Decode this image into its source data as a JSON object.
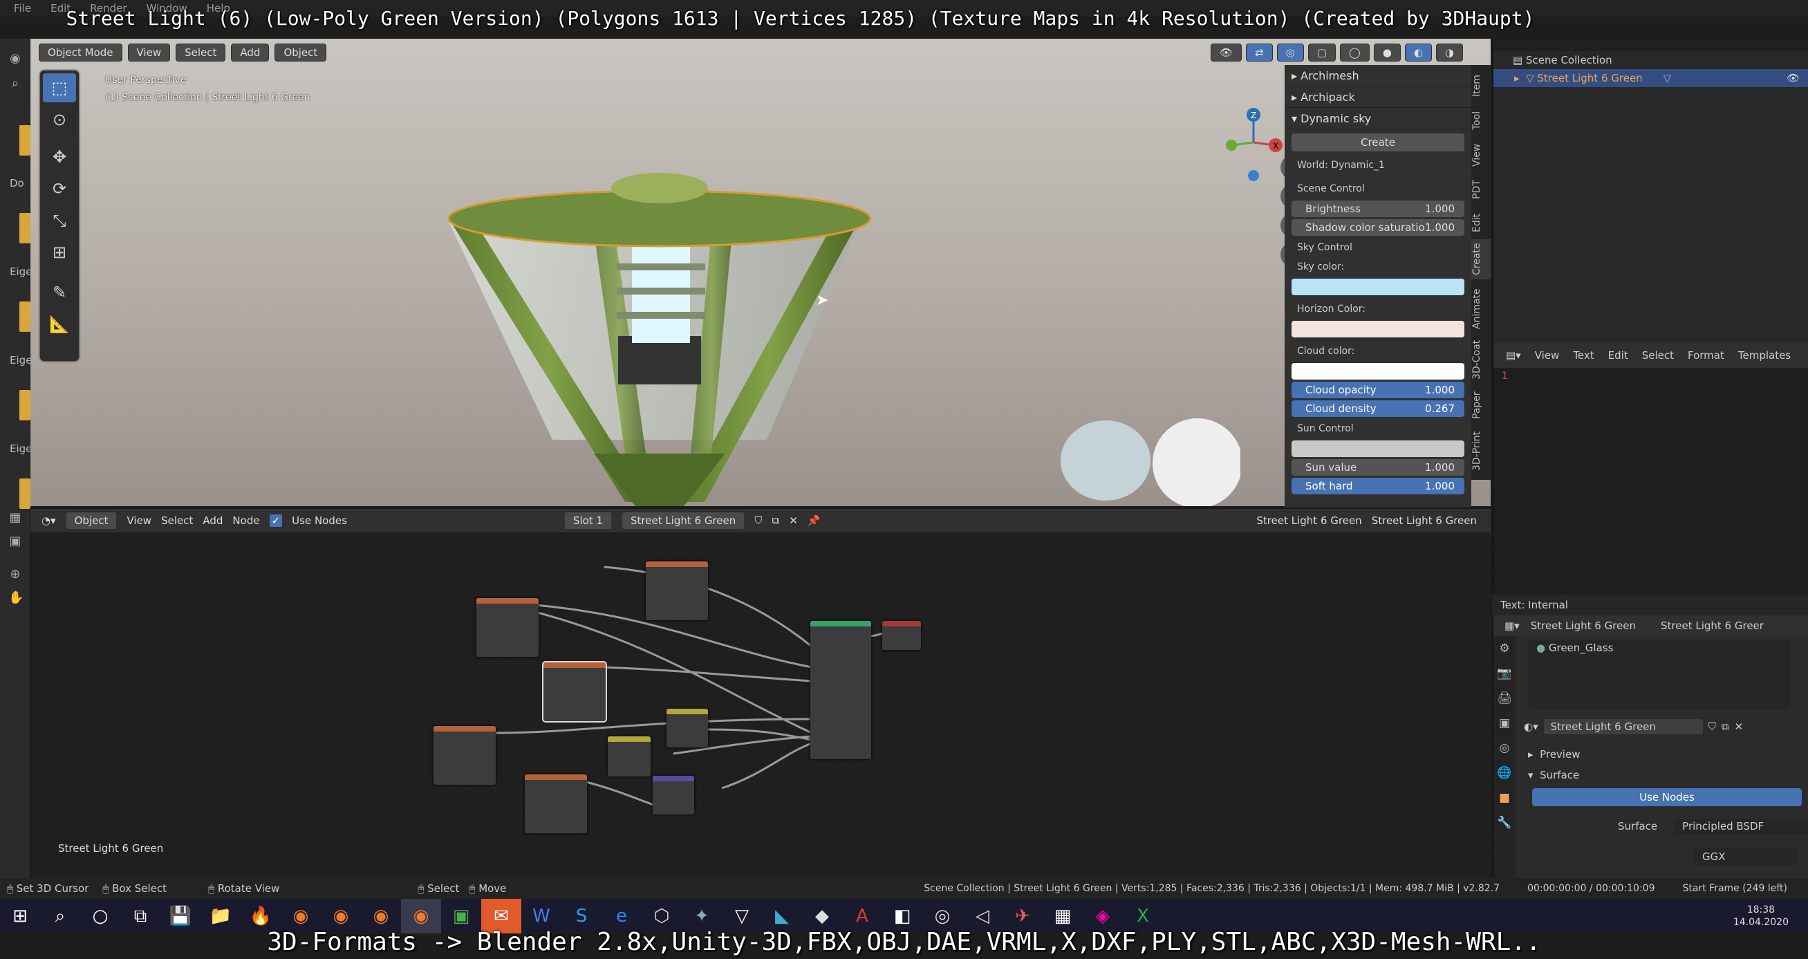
{
  "video_title": "Street Light (6) (Low-Poly Green Version) (Polygons 1613 | Vertices 1285) (Texture Maps in 4k Resolution) (Created by 3DHaupt)",
  "subtitle": "3D-Formats -> Blender 2.8x,Unity-3D,FBX,OBJ,DAE,VRML,X,DXF,PLY,STL,ABC,X3D-Mesh-WRL..",
  "menu": [
    "File",
    "Edit",
    "Render",
    "Window",
    "Help"
  ],
  "left_strip_labels": [
    "Do",
    "Eige",
    "Eige",
    "Eige"
  ],
  "viewport": {
    "mode": "Object Mode",
    "menus": [
      "View",
      "Select",
      "Add",
      "Object"
    ],
    "perspective": "User Perspective",
    "collection_info": "(1) Scene Collection | Street Light 6 Green",
    "axes": {
      "z": "Z",
      "x": "X"
    }
  },
  "npanel": {
    "sections": [
      "Archimesh",
      "Archipack",
      "Dynamic sky"
    ],
    "create_btn": "Create",
    "world": "World: Dynamic_1",
    "scene_control": "Scene Control",
    "brightness_label": "Brightness",
    "brightness_val": "1.000",
    "shadow_label": "Shadow color saturatio",
    "shadow_val": "1.000",
    "sky_control": "Sky Control",
    "sky_color": "Sky color:",
    "horizon_color": "Horizon Color:",
    "cloud_color": "Cloud color:",
    "cloud_opacity_label": "Cloud opacity",
    "cloud_opacity_val": "1.000",
    "cloud_density_label": "Cloud density",
    "cloud_density_val": "0.267",
    "sun_control": "Sun Control",
    "sun_value_label": "Sun value",
    "sun_value_val": "1.000",
    "soft_hard_label": "Soft hard",
    "soft_hard_val": "1.000",
    "colors": {
      "sky": "#b8e4f5",
      "horizon": "#f5e4dd",
      "cloud": "#ffffff",
      "sun": "#c8c8c8"
    }
  },
  "vtabs": [
    "Item",
    "Tool",
    "View",
    "PDT",
    "Edit",
    "Create",
    "Animate",
    "3D-Coat",
    "Paper",
    "3D-Print"
  ],
  "node_header": {
    "type": "Object",
    "menus": [
      "View",
      "Select",
      "Add",
      "Node"
    ],
    "use_nodes": "Use Nodes",
    "slot": "Slot 1",
    "material": "Street Light 6 Green",
    "object1": "Street Light 6 Green",
    "object2": "Street Light 6 Green"
  },
  "node_editor_label": "Street Light 6 Green",
  "outliner": {
    "root": "Scene Collection",
    "item": "Street Light 6 Green"
  },
  "text_editor": {
    "menus": [
      "View",
      "Text",
      "Edit",
      "Select",
      "Format",
      "Templates"
    ],
    "line_no": "1",
    "footer": "Text: Internal"
  },
  "properties": {
    "object": "Street Light 6 Green",
    "object2": "Street Light 6 Greer",
    "slot_material": "Green_Glass",
    "material": "Street Light 6 Green",
    "preview": "Preview",
    "surface_section": "Surface",
    "use_nodes_btn": "Use Nodes",
    "surface_label": "Surface",
    "surface_value": "Principled BSDF",
    "distribution": "GGX"
  },
  "statusbar": {
    "set_cursor": "Set 3D Cursor",
    "box_select": "Box Select",
    "rotate_view": "Rotate View",
    "select": "Select",
    "move": "Move",
    "stats": "Scene Collection | Street Light 6 Green | Verts:1,285 | Faces:2,336 | Tris:2,336 | Objects:1/1 | Mem: 498.7 MiB | v2.82.7",
    "timecode": "00:00:00:00 / 00:00:10:09",
    "start_frame": "Start Frame (249 left)"
  },
  "taskbar": {
    "time": "18:38",
    "date": "14.04.2020"
  }
}
